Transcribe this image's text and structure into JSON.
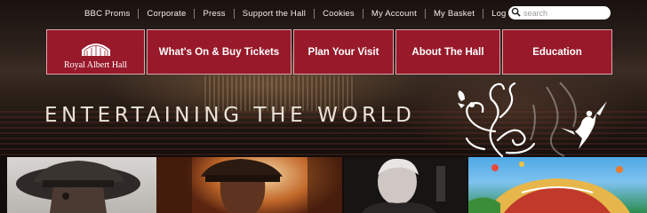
{
  "utility_nav": {
    "links": [
      "BBC Proms",
      "Corporate",
      "Press",
      "Support the Hall",
      "Cookies",
      "My Account",
      "My Basket",
      "Log In"
    ]
  },
  "search": {
    "placeholder": "search"
  },
  "logo": {
    "text": "Royal Albert Hall"
  },
  "main_nav": {
    "items": [
      "What's On & Buy Tickets",
      "Plan Your Visit",
      "About The Hall",
      "Education"
    ]
  },
  "hero": {
    "slogan": "ENTERTAINING THE WORLD"
  },
  "colors": {
    "brand_red": "#98192a",
    "nav_border": "#d9a7ad",
    "utility_text": "#f2ece6"
  },
  "icons": {
    "search": "search-icon",
    "logo": "hall-logo-icon",
    "swirl": "swirl-dancer-graphic"
  }
}
